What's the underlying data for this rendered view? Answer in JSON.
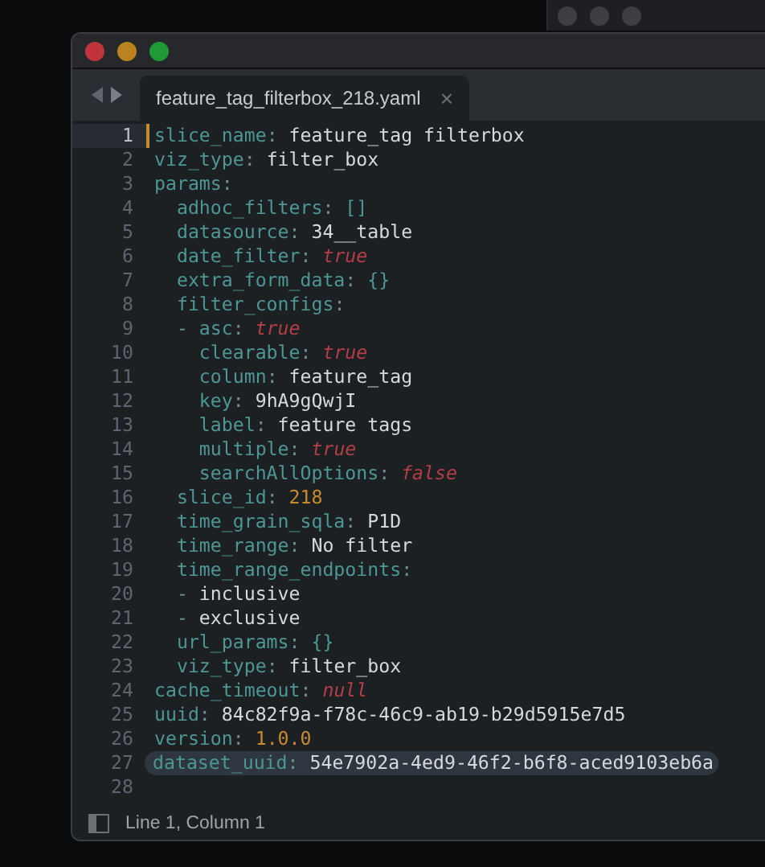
{
  "window": {
    "tab": {
      "title": "feature_tag_filterbox_218.yaml",
      "close": "×",
      "selected": true
    }
  },
  "editor": {
    "lines": [
      {
        "number": "1",
        "current": true,
        "highlighted": false,
        "tokens": [
          {
            "text": "slice_name",
            "kind": "key"
          },
          {
            "text": ": ",
            "kind": "punct"
          },
          {
            "text": "feature_tag filterbox",
            "kind": "plain"
          }
        ]
      },
      {
        "number": "2",
        "current": false,
        "highlighted": false,
        "tokens": [
          {
            "text": "viz_type",
            "kind": "key"
          },
          {
            "text": ": ",
            "kind": "punct"
          },
          {
            "text": "filter_box",
            "kind": "plain"
          }
        ]
      },
      {
        "number": "3",
        "current": false,
        "highlighted": false,
        "tokens": [
          {
            "text": "params",
            "kind": "key"
          },
          {
            "text": ":",
            "kind": "punct"
          }
        ]
      },
      {
        "number": "4",
        "current": false,
        "highlighted": false,
        "tokens": [
          {
            "text": "  adhoc_filters",
            "kind": "key"
          },
          {
            "text": ": ",
            "kind": "punct"
          },
          {
            "text": "[]",
            "kind": "bracket"
          }
        ]
      },
      {
        "number": "5",
        "current": false,
        "highlighted": false,
        "tokens": [
          {
            "text": "  datasource",
            "kind": "key"
          },
          {
            "text": ": ",
            "kind": "punct"
          },
          {
            "text": "34__table",
            "kind": "plain"
          }
        ]
      },
      {
        "number": "6",
        "current": false,
        "highlighted": false,
        "tokens": [
          {
            "text": "  date_filter",
            "kind": "key"
          },
          {
            "text": ": ",
            "kind": "punct"
          },
          {
            "text": "true",
            "kind": "constant"
          }
        ]
      },
      {
        "number": "7",
        "current": false,
        "highlighted": false,
        "tokens": [
          {
            "text": "  extra_form_data",
            "kind": "key"
          },
          {
            "text": ": ",
            "kind": "punct"
          },
          {
            "text": "{}",
            "kind": "bracket"
          }
        ]
      },
      {
        "number": "8",
        "current": false,
        "highlighted": false,
        "tokens": [
          {
            "text": "  filter_configs",
            "kind": "key"
          },
          {
            "text": ":",
            "kind": "punct"
          }
        ]
      },
      {
        "number": "9",
        "current": false,
        "highlighted": false,
        "tokens": [
          {
            "text": "  - ",
            "kind": "punct"
          },
          {
            "text": "asc",
            "kind": "key"
          },
          {
            "text": ": ",
            "kind": "punct"
          },
          {
            "text": "true",
            "kind": "constant"
          }
        ]
      },
      {
        "number": "10",
        "current": false,
        "highlighted": false,
        "tokens": [
          {
            "text": "    clearable",
            "kind": "key"
          },
          {
            "text": ": ",
            "kind": "punct"
          },
          {
            "text": "true",
            "kind": "constant"
          }
        ]
      },
      {
        "number": "11",
        "current": false,
        "highlighted": false,
        "tokens": [
          {
            "text": "    column",
            "kind": "key"
          },
          {
            "text": ": ",
            "kind": "punct"
          },
          {
            "text": "feature_tag",
            "kind": "plain"
          }
        ]
      },
      {
        "number": "12",
        "current": false,
        "highlighted": false,
        "tokens": [
          {
            "text": "    key",
            "kind": "key"
          },
          {
            "text": ": ",
            "kind": "punct"
          },
          {
            "text": "9hA9gQwjI",
            "kind": "plain"
          }
        ]
      },
      {
        "number": "13",
        "current": false,
        "highlighted": false,
        "tokens": [
          {
            "text": "    label",
            "kind": "key"
          },
          {
            "text": ": ",
            "kind": "punct"
          },
          {
            "text": "feature tags",
            "kind": "plain"
          }
        ]
      },
      {
        "number": "14",
        "current": false,
        "highlighted": false,
        "tokens": [
          {
            "text": "    multiple",
            "kind": "key"
          },
          {
            "text": ": ",
            "kind": "punct"
          },
          {
            "text": "true",
            "kind": "constant"
          }
        ]
      },
      {
        "number": "15",
        "current": false,
        "highlighted": false,
        "tokens": [
          {
            "text": "    searchAllOptions",
            "kind": "key"
          },
          {
            "text": ": ",
            "kind": "punct"
          },
          {
            "text": "false",
            "kind": "constant"
          }
        ]
      },
      {
        "number": "16",
        "current": false,
        "highlighted": false,
        "tokens": [
          {
            "text": "  slice_id",
            "kind": "key"
          },
          {
            "text": ": ",
            "kind": "punct"
          },
          {
            "text": "218",
            "kind": "number"
          }
        ]
      },
      {
        "number": "17",
        "current": false,
        "highlighted": false,
        "tokens": [
          {
            "text": "  time_grain_sqla",
            "kind": "key"
          },
          {
            "text": ": ",
            "kind": "punct"
          },
          {
            "text": "P1D",
            "kind": "plain"
          }
        ]
      },
      {
        "number": "18",
        "current": false,
        "highlighted": false,
        "tokens": [
          {
            "text": "  time_range",
            "kind": "key"
          },
          {
            "text": ": ",
            "kind": "punct"
          },
          {
            "text": "No filter",
            "kind": "plain"
          }
        ]
      },
      {
        "number": "19",
        "current": false,
        "highlighted": false,
        "tokens": [
          {
            "text": "  time_range_endpoints",
            "kind": "key"
          },
          {
            "text": ":",
            "kind": "punct"
          }
        ]
      },
      {
        "number": "20",
        "current": false,
        "highlighted": false,
        "tokens": [
          {
            "text": "  - ",
            "kind": "punct"
          },
          {
            "text": "inclusive",
            "kind": "plain"
          }
        ]
      },
      {
        "number": "21",
        "current": false,
        "highlighted": false,
        "tokens": [
          {
            "text": "  - ",
            "kind": "punct"
          },
          {
            "text": "exclusive",
            "kind": "plain"
          }
        ]
      },
      {
        "number": "22",
        "current": false,
        "highlighted": false,
        "tokens": [
          {
            "text": "  url_params",
            "kind": "key"
          },
          {
            "text": ": ",
            "kind": "punct"
          },
          {
            "text": "{}",
            "kind": "bracket"
          }
        ]
      },
      {
        "number": "23",
        "current": false,
        "highlighted": false,
        "tokens": [
          {
            "text": "  viz_type",
            "kind": "key"
          },
          {
            "text": ": ",
            "kind": "punct"
          },
          {
            "text": "filter_box",
            "kind": "plain"
          }
        ]
      },
      {
        "number": "24",
        "current": false,
        "highlighted": false,
        "tokens": [
          {
            "text": "cache_timeout",
            "kind": "key"
          },
          {
            "text": ": ",
            "kind": "punct"
          },
          {
            "text": "null",
            "kind": "constant"
          }
        ]
      },
      {
        "number": "25",
        "current": false,
        "highlighted": false,
        "tokens": [
          {
            "text": "uuid",
            "kind": "key"
          },
          {
            "text": ": ",
            "kind": "punct"
          },
          {
            "text": "84c82f9a-f78c-46c9-ab19-b29d5915e7d5",
            "kind": "plain"
          }
        ]
      },
      {
        "number": "26",
        "current": false,
        "highlighted": false,
        "tokens": [
          {
            "text": "version",
            "kind": "key"
          },
          {
            "text": ": ",
            "kind": "punct"
          },
          {
            "text": "1.0.0",
            "kind": "number"
          }
        ]
      },
      {
        "number": "27",
        "current": false,
        "highlighted": true,
        "tokens": [
          {
            "text": "dataset_uuid",
            "kind": "key"
          },
          {
            "text": ": ",
            "kind": "punct"
          },
          {
            "text": "54e7902a-4ed9-46f2-b6f8-aced9103eb6a",
            "kind": "plain"
          }
        ]
      },
      {
        "number": "28",
        "current": false,
        "highlighted": false
      }
    ]
  },
  "status_bar": {
    "position": "Line 1, Column 1"
  }
}
